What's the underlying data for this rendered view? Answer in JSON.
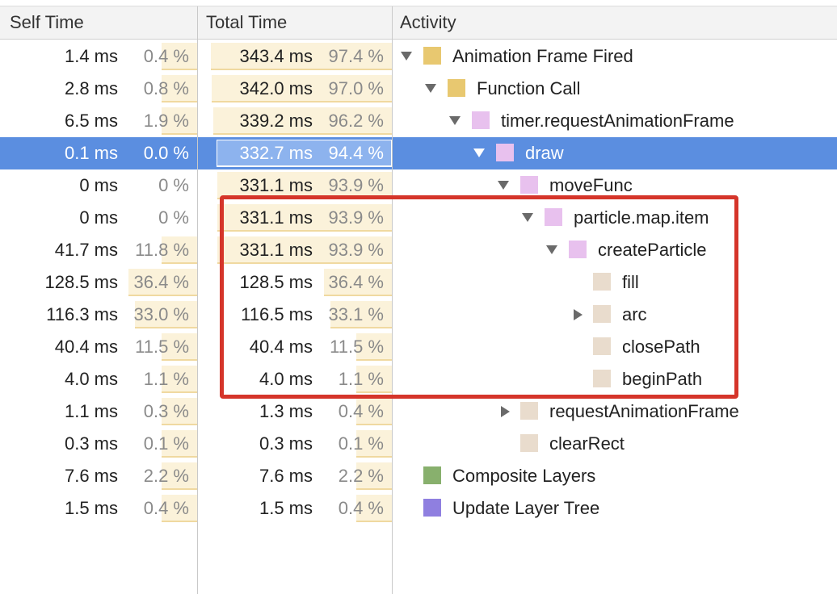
{
  "header": {
    "self_time": "Self Time",
    "total_time": "Total Time",
    "activity": "Activity"
  },
  "colors": {
    "scripting": "#e8c870",
    "js_function": "#e8c1ee",
    "painting_call": "#e9dccd",
    "composite": "#88b06d",
    "update_layer": "#8f7fe0",
    "selected_row": "#5b8ee0",
    "highlight_box": "#d5352a"
  },
  "rows": [
    {
      "self_ms": "1.4 ms",
      "self_pct": "0.4 %",
      "self_bar": 0.004,
      "total_ms": "343.4 ms",
      "total_pct": "97.4 %",
      "total_bar": 0.974,
      "name": "Animation Frame Fired",
      "depth": 0,
      "expand": "down",
      "color": "scripting"
    },
    {
      "self_ms": "2.8 ms",
      "self_pct": "0.8 %",
      "self_bar": 0.008,
      "total_ms": "342.0 ms",
      "total_pct": "97.0 %",
      "total_bar": 0.97,
      "name": "Function Call",
      "depth": 1,
      "expand": "down",
      "color": "scripting"
    },
    {
      "self_ms": "6.5 ms",
      "self_pct": "1.9 %",
      "self_bar": 0.019,
      "total_ms": "339.2 ms",
      "total_pct": "96.2 %",
      "total_bar": 0.962,
      "name": "timer.requestAnimationFrame",
      "depth": 2,
      "expand": "down",
      "color": "js_function"
    },
    {
      "self_ms": "0.1 ms",
      "self_pct": "0.0 %",
      "self_bar": 0.0,
      "total_ms": "332.7 ms",
      "total_pct": "94.4 %",
      "total_bar": 0.944,
      "name": "draw",
      "depth": 3,
      "expand": "down",
      "color": "js_function",
      "selected": true
    },
    {
      "self_ms": "0 ms",
      "self_pct": "0 %",
      "self_bar": 0.0,
      "total_ms": "331.1 ms",
      "total_pct": "93.9 %",
      "total_bar": 0.939,
      "name": "moveFunc",
      "depth": 4,
      "expand": "down",
      "color": "js_function"
    },
    {
      "self_ms": "0 ms",
      "self_pct": "0 %",
      "self_bar": 0.0,
      "total_ms": "331.1 ms",
      "total_pct": "93.9 %",
      "total_bar": 0.939,
      "name": "particle.map.item",
      "depth": 5,
      "expand": "down",
      "color": "js_function"
    },
    {
      "self_ms": "41.7 ms",
      "self_pct": "11.8 %",
      "self_bar": 0.118,
      "total_ms": "331.1 ms",
      "total_pct": "93.9 %",
      "total_bar": 0.939,
      "name": "createParticle",
      "depth": 6,
      "expand": "down",
      "color": "js_function"
    },
    {
      "self_ms": "128.5 ms",
      "self_pct": "36.4 %",
      "self_bar": 0.364,
      "total_ms": "128.5 ms",
      "total_pct": "36.4 %",
      "total_bar": 0.364,
      "name": "fill",
      "depth": 7,
      "expand": "none",
      "color": "painting_call"
    },
    {
      "self_ms": "116.3 ms",
      "self_pct": "33.0 %",
      "self_bar": 0.33,
      "total_ms": "116.5 ms",
      "total_pct": "33.1 %",
      "total_bar": 0.331,
      "name": "arc",
      "depth": 7,
      "expand": "right",
      "color": "painting_call"
    },
    {
      "self_ms": "40.4 ms",
      "self_pct": "11.5 %",
      "self_bar": 0.115,
      "total_ms": "40.4 ms",
      "total_pct": "11.5 %",
      "total_bar": 0.115,
      "name": "closePath",
      "depth": 7,
      "expand": "none",
      "color": "painting_call"
    },
    {
      "self_ms": "4.0 ms",
      "self_pct": "1.1 %",
      "self_bar": 0.011,
      "total_ms": "4.0 ms",
      "total_pct": "1.1 %",
      "total_bar": 0.011,
      "name": "beginPath",
      "depth": 7,
      "expand": "none",
      "color": "painting_call"
    },
    {
      "self_ms": "1.1 ms",
      "self_pct": "0.3 %",
      "self_bar": 0.003,
      "total_ms": "1.3 ms",
      "total_pct": "0.4 %",
      "total_bar": 0.004,
      "name": "requestAnimationFrame",
      "depth": 4,
      "expand": "right",
      "color": "painting_call"
    },
    {
      "self_ms": "0.3 ms",
      "self_pct": "0.1 %",
      "self_bar": 0.001,
      "total_ms": "0.3 ms",
      "total_pct": "0.1 %",
      "total_bar": 0.001,
      "name": "clearRect",
      "depth": 4,
      "expand": "none",
      "color": "painting_call"
    },
    {
      "self_ms": "7.6 ms",
      "self_pct": "2.2 %",
      "self_bar": 0.022,
      "total_ms": "7.6 ms",
      "total_pct": "2.2 %",
      "total_bar": 0.022,
      "name": "Composite Layers",
      "depth": 0,
      "expand": "none",
      "color": "composite"
    },
    {
      "self_ms": "1.5 ms",
      "self_pct": "0.4 %",
      "self_bar": 0.004,
      "total_ms": "1.5 ms",
      "total_pct": "0.4 %",
      "total_bar": 0.004,
      "name": "Update Layer Tree",
      "depth": 0,
      "expand": "none",
      "color": "update_layer"
    }
  ]
}
